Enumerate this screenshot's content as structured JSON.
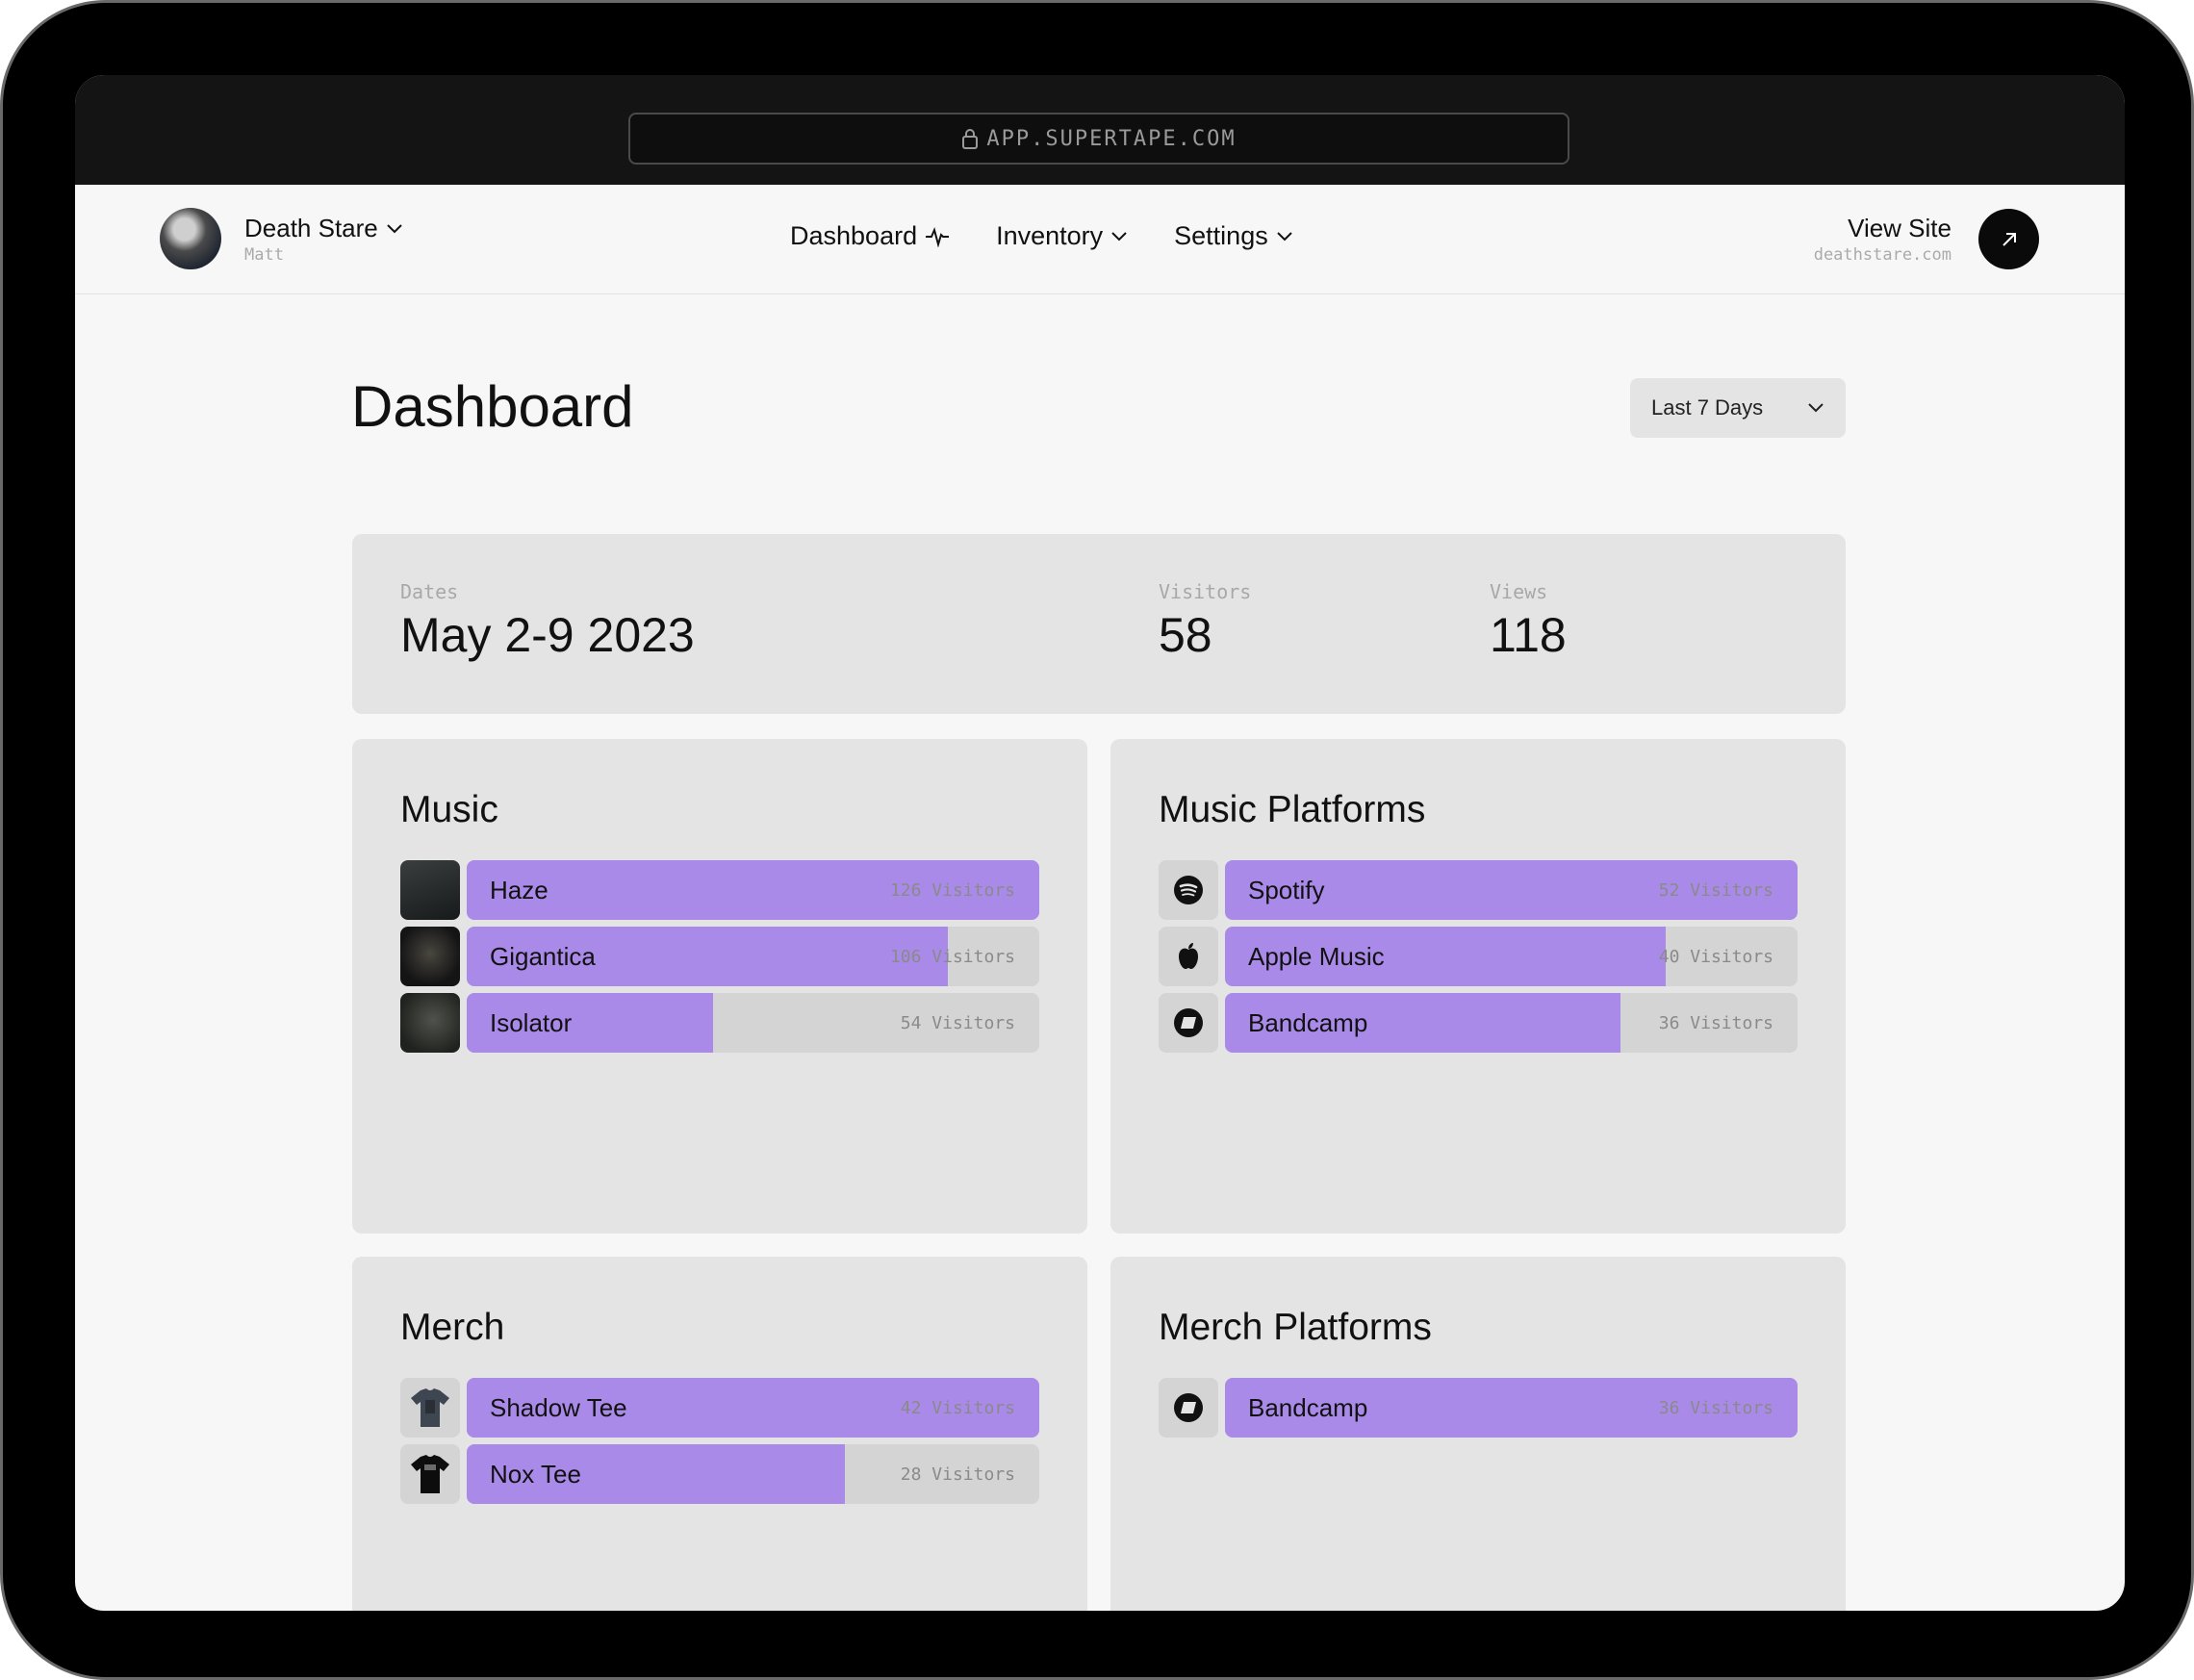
{
  "browser": {
    "url": "APP.SUPERTAPE.COM"
  },
  "account": {
    "name": "Death Stare",
    "user": "Matt"
  },
  "nav": {
    "dashboard": "Dashboard",
    "inventory": "Inventory",
    "settings": "Settings"
  },
  "view_site": {
    "label": "View Site",
    "domain": "deathstare.com"
  },
  "page": {
    "title": "Dashboard",
    "range": "Last 7 Days"
  },
  "summary": {
    "dates_label": "Dates",
    "dates_value": "May 2-9 2023",
    "visitors_label": "Visitors",
    "visitors_value": "58",
    "views_label": "Views",
    "views_value": "118"
  },
  "music": {
    "title": "Music",
    "items": [
      {
        "name": "Haze",
        "count": "126 Visitors",
        "fraction": 1.0
      },
      {
        "name": "Gigantica",
        "count": "106 Visitors",
        "fraction": 0.84
      },
      {
        "name": "Isolator",
        "count": "54 Visitors",
        "fraction": 0.43
      }
    ]
  },
  "music_platforms": {
    "title": "Music Platforms",
    "items": [
      {
        "name": "Spotify",
        "count": "52 Visitors",
        "fraction": 1.0,
        "icon": "spotify-icon"
      },
      {
        "name": "Apple Music",
        "count": "40 Visitors",
        "fraction": 0.77,
        "icon": "apple-icon"
      },
      {
        "name": "Bandcamp",
        "count": "36 Visitors",
        "fraction": 0.69,
        "icon": "bandcamp-icon"
      }
    ]
  },
  "merch": {
    "title": "Merch",
    "items": [
      {
        "name": "Shadow Tee",
        "count": "42 Visitors",
        "fraction": 1.0
      },
      {
        "name": "Nox Tee",
        "count": "28 Visitors",
        "fraction": 0.66
      }
    ]
  },
  "merch_platforms": {
    "title": "Merch Platforms",
    "items": [
      {
        "name": "Bandcamp",
        "count": "36 Visitors",
        "fraction": 1.0,
        "icon": "bandcamp-icon"
      }
    ]
  },
  "colors": {
    "bar_fill": "#a98ae8",
    "bar_track": "#d4d4d4",
    "card": "#e4e4e4"
  }
}
